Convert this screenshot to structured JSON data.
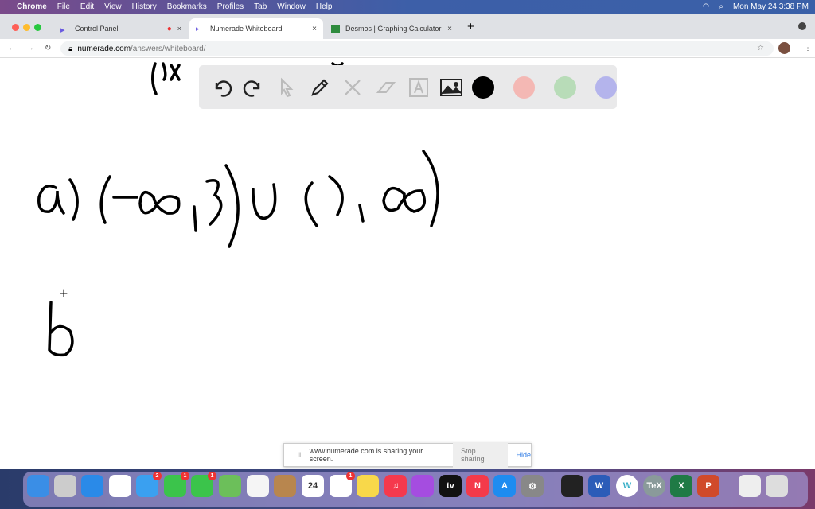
{
  "menubar": {
    "app": "Chrome",
    "items": [
      "File",
      "Edit",
      "View",
      "History",
      "Bookmarks",
      "Profiles",
      "Tab",
      "Window",
      "Help"
    ],
    "clock": "Mon May 24  3:38 PM"
  },
  "tabs": [
    {
      "label": "Control Panel"
    },
    {
      "label": "Numerade Whiteboard"
    },
    {
      "label": "Desmos | Graphing Calculator"
    }
  ],
  "address": {
    "domain": "numerade.com",
    "path": "/answers/whiteboard/"
  },
  "toolbar": {
    "tools": [
      "undo-icon",
      "redo-icon",
      "pointer-icon",
      "pen-icon",
      "tools-icon",
      "eraser-icon",
      "text-icon",
      "image-icon"
    ],
    "colors": [
      "#000000",
      "#f4b8b4",
      "#b8dcb8",
      "#b4b4ec"
    ]
  },
  "share": {
    "message": "www.numerade.com is sharing your screen.",
    "stop": "Stop sharing",
    "hide": "Hide"
  },
  "dock": {
    "apps": [
      {
        "name": "finder",
        "color": "#3a8ee6",
        "label": ""
      },
      {
        "name": "launchpad",
        "color": "#ccc",
        "label": ""
      },
      {
        "name": "safari",
        "color": "#2a8ae8",
        "label": ""
      },
      {
        "name": "chrome",
        "color": "#fff",
        "label": ""
      },
      {
        "name": "mail",
        "color": "#3aa0f0",
        "label": "",
        "badge": "2"
      },
      {
        "name": "facetime",
        "color": "#3bc44b",
        "label": "",
        "badge": "1"
      },
      {
        "name": "messages",
        "color": "#3bc44b",
        "label": "",
        "badge": "1"
      },
      {
        "name": "maps",
        "color": "#6cbf5a",
        "label": ""
      },
      {
        "name": "photos",
        "color": "#f5f5f5",
        "label": ""
      },
      {
        "name": "contacts",
        "color": "#b8864e",
        "label": ""
      },
      {
        "name": "calendar",
        "color": "#fff",
        "label": "24"
      },
      {
        "name": "reminders",
        "color": "#fff",
        "label": "",
        "badge": "1"
      },
      {
        "name": "notes",
        "color": "#f8d84a",
        "label": ""
      },
      {
        "name": "music",
        "color": "#f5394d",
        "label": "♫"
      },
      {
        "name": "podcasts",
        "color": "#a54de0",
        "label": ""
      },
      {
        "name": "tv",
        "color": "#111",
        "label": "tv"
      },
      {
        "name": "news",
        "color": "#f43a4a",
        "label": "N"
      },
      {
        "name": "app-store",
        "color": "#1e8cf0",
        "label": "A"
      },
      {
        "name": "system-preferences",
        "color": "#888",
        "label": "⚙"
      },
      {
        "name": "activity-monitor",
        "color": "#222",
        "label": ""
      },
      {
        "name": "word",
        "color": "#2b5cb8",
        "label": "W"
      },
      {
        "name": "whiteboard",
        "color": "#fff",
        "label": "W"
      },
      {
        "name": "tex",
        "color": "#8a9a9a",
        "label": "TeX"
      },
      {
        "name": "excel",
        "color": "#1f7a45",
        "label": "X"
      },
      {
        "name": "powerpoint",
        "color": "#d04a2a",
        "label": "P"
      },
      {
        "name": "document",
        "color": "#eee",
        "label": ""
      },
      {
        "name": "trash",
        "color": "#ddd",
        "label": ""
      }
    ]
  }
}
